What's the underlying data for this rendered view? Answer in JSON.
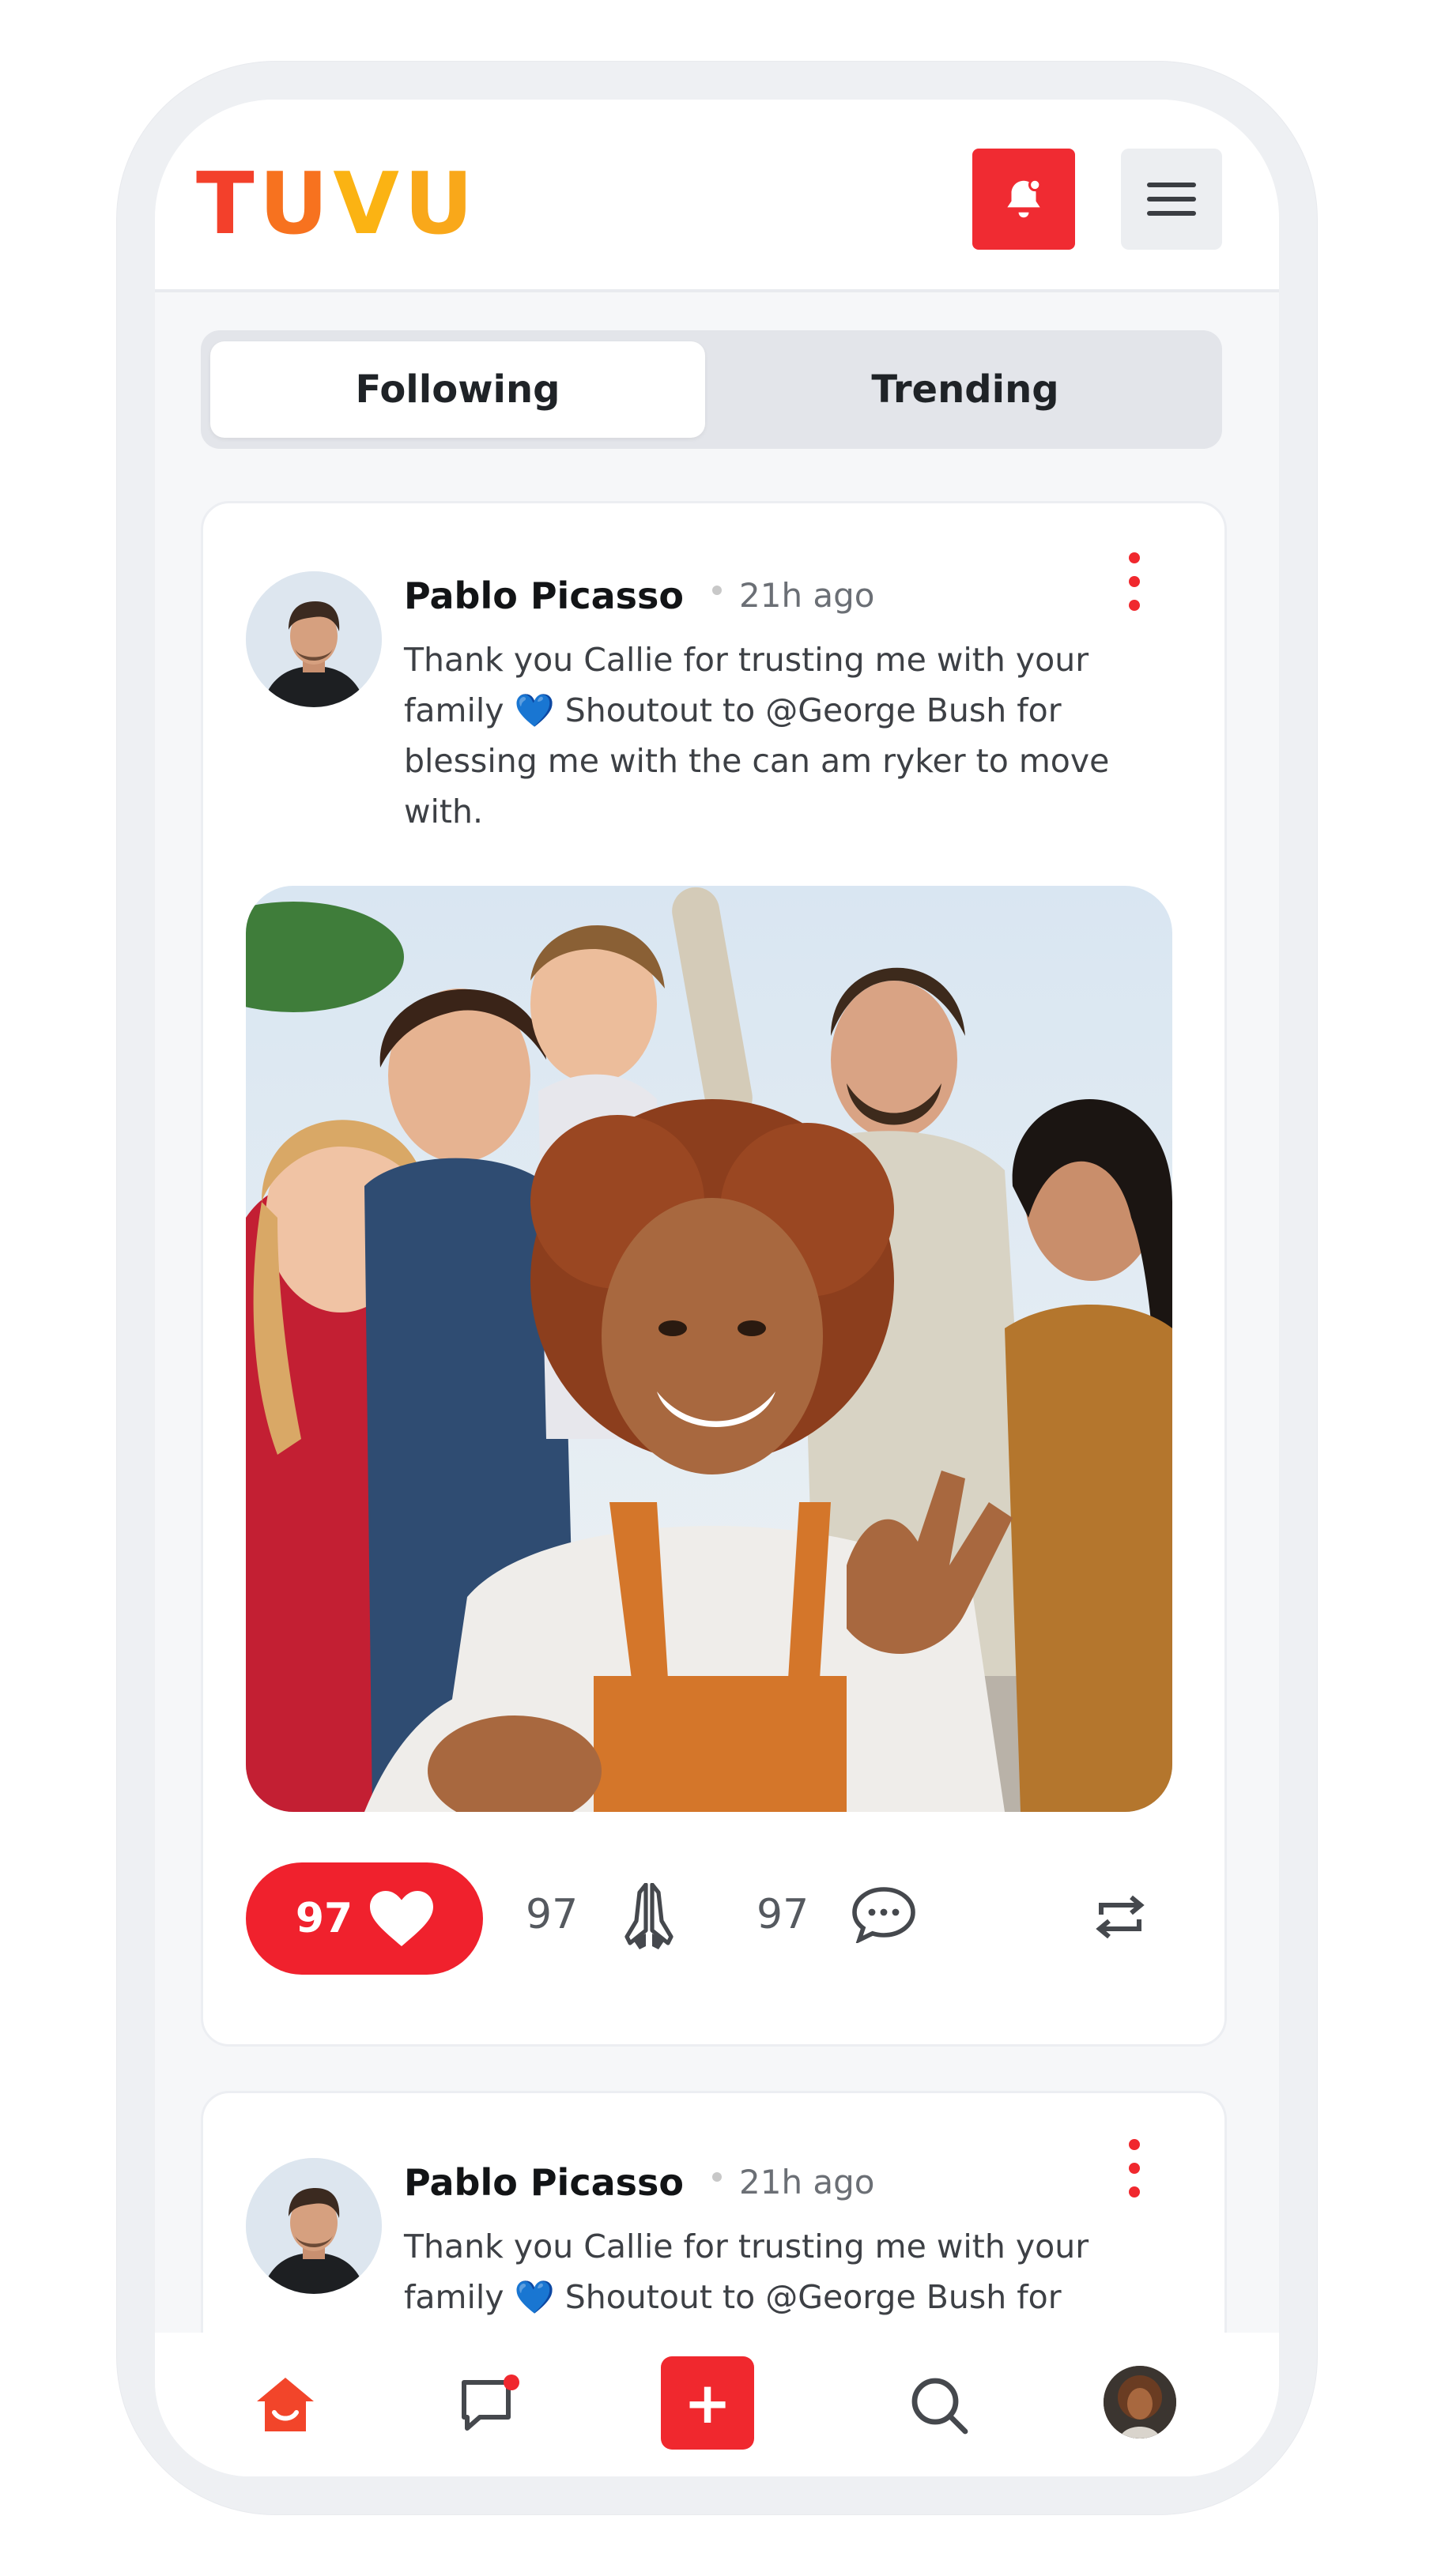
{
  "brand": {
    "logo_letters": [
      "T",
      "U",
      "V",
      "U"
    ],
    "colors": {
      "primary_red": "#f02b32",
      "orange": "#f7721f",
      "yellow": "#fbb313"
    }
  },
  "header": {
    "bell_icon": "notification-bell-icon",
    "menu_icon": "hamburger-menu-icon"
  },
  "tabs": [
    {
      "label": "Following",
      "active": true
    },
    {
      "label": "Trending",
      "active": false
    }
  ],
  "posts": [
    {
      "author": "Pablo Picasso",
      "time": "21h ago",
      "text_before_emoji": "Thank you Callie for trusting me with your family",
      "emoji": "💙",
      "text_after_emoji": " Shoutout to @George Bush for blessing me with the can am ryker to move with.",
      "likes": "97",
      "prays": "97",
      "comments": "97"
    },
    {
      "author": "Pablo Picasso",
      "time": "21h ago",
      "text_before_emoji": "Thank you Callie for trusting me with your family",
      "emoji": "💙",
      "text_after_emoji": " Shoutout to @George Bush for"
    }
  ],
  "bottom_nav": {
    "add_label": "+"
  }
}
